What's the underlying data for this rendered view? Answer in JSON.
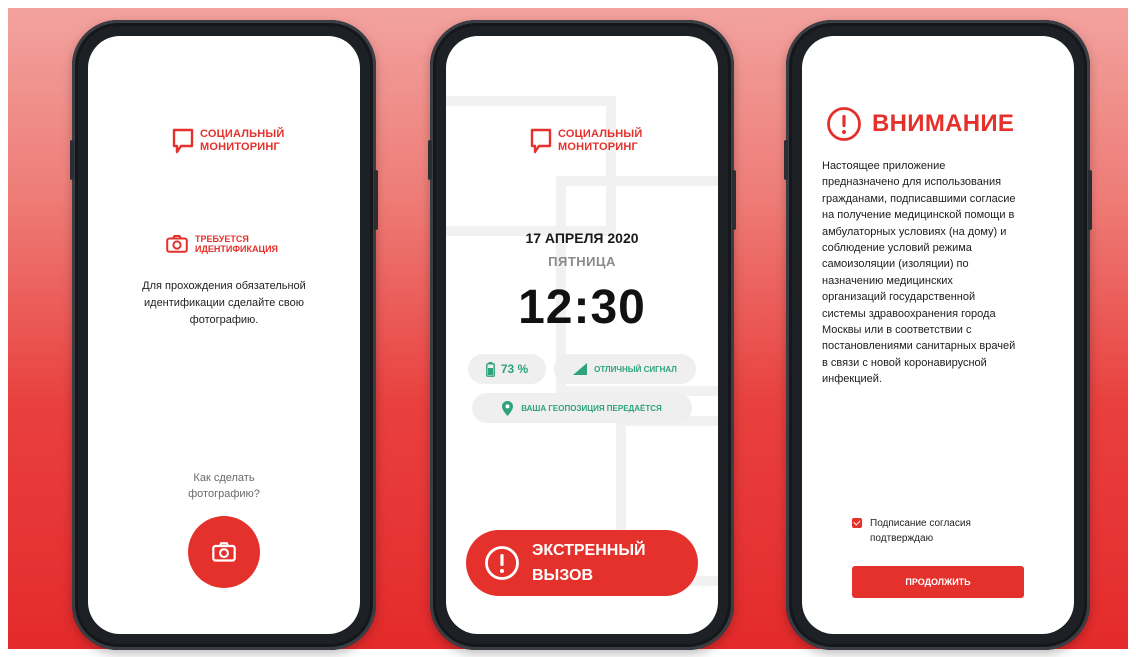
{
  "logo": {
    "line1": "СОЦИАЛЬНЫЙ",
    "line2": "МОНИТОРИНГ"
  },
  "screen1": {
    "ident_line1": "ТРЕБУЕТСЯ",
    "ident_line2": "ИДЕНТИФИКАЦИЯ",
    "instruction_line1": "Для прохождения обязательной",
    "instruction_line2": "идентификации сделайте свою",
    "instruction_line3": "фотографию.",
    "howto_line1": "Как сделать",
    "howto_line2": "фотографию?",
    "camera_icon": "camera-icon"
  },
  "screen2": {
    "date": "17 АПРЕЛЯ 2020",
    "weekday": "ПЯТНИЦА",
    "time": "12:30",
    "battery": "73 %",
    "signal": "ОТЛИЧНЫЙ СИГНАЛ",
    "geo": "ВАША ГЕОПОЗИЦИЯ ПЕРЕДАЁТСЯ",
    "emergency_line1": "ЭКСТРЕННЫЙ",
    "emergency_line2": "ВЫЗОВ"
  },
  "screen3": {
    "title": "ВНИМАНИЕ",
    "paragraph_lines": [
      "Настоящее приложение",
      "предназначено для использования",
      "гражданами, подписавшими согласие",
      "на получение медицинской помощи в",
      "амбулаторных условиях (на дому) и",
      "соблюдение условий режима",
      "самоизоляции (изоляции) по",
      "назначению медицинских",
      "организаций государственной",
      "системы здравоохранения города",
      "Москвы или в соответствии с",
      "постановлениями санитарных врачей",
      "в связи с новой коронавирусной",
      "инфекцией."
    ],
    "consent_line1": "Подписание согласия",
    "consent_line2": "подтверждаю",
    "consent_checked": true,
    "continue_label": "ПРОДОЛЖИТЬ"
  },
  "colors": {
    "accent": "#e5312c",
    "status_green": "#2ea37a",
    "chip_bg": "#efefef"
  }
}
